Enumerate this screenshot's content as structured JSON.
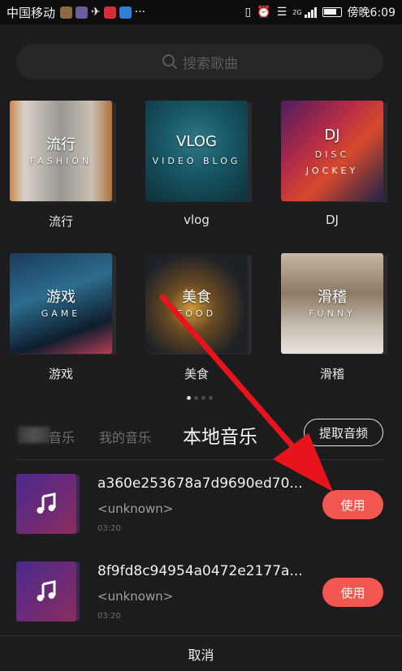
{
  "status_bar": {
    "carrier": "中国移动",
    "network": "2G",
    "time_label": "傍晚6:09",
    "app_icon_colors": [
      "#8a6a3e",
      "#6e5b9e",
      "#e8e8e8",
      "#d82c3a",
      "#2f7ed8"
    ]
  },
  "search": {
    "placeholder": "搜索歌曲",
    "icon": "search-icon"
  },
  "categories": [
    {
      "title": "流行",
      "subtitle": "FASHION",
      "label": "流行"
    },
    {
      "title": "VLOG",
      "subtitle": "VIDEO BLOG",
      "label": "vlog"
    },
    {
      "title": "DJ",
      "subtitle": "DISC",
      "subtitle2": "JOCKEY",
      "label": "DJ"
    },
    {
      "title": "游戏",
      "subtitle": "GAME",
      "label": "游戏"
    },
    {
      "title": "美食",
      "subtitle": "FOOD",
      "label": "美食"
    },
    {
      "title": "滑稽",
      "subtitle": "FUNNY",
      "label": "滑稽"
    }
  ],
  "pager": {
    "pages": 4,
    "current": 1
  },
  "tabs": {
    "tab1_partial": "音乐",
    "tab2": "我的音乐",
    "tab3_active": "本地音乐",
    "extract_button": "提取音频"
  },
  "tracks": [
    {
      "name": "a360e253678a7d9690ed70...",
      "artist": "<unknown>",
      "duration": "03:20",
      "use_label": "使用"
    },
    {
      "name": "8f9fd8c94954a0472e2177a...",
      "artist": "<unknown>",
      "duration": "03:20",
      "use_label": "使用"
    }
  ],
  "bottom": {
    "cancel_label": "取消"
  },
  "colors": {
    "background": "#1c1c1e",
    "accent": "#f2584f",
    "annotation_arrow": "#e8141b"
  }
}
